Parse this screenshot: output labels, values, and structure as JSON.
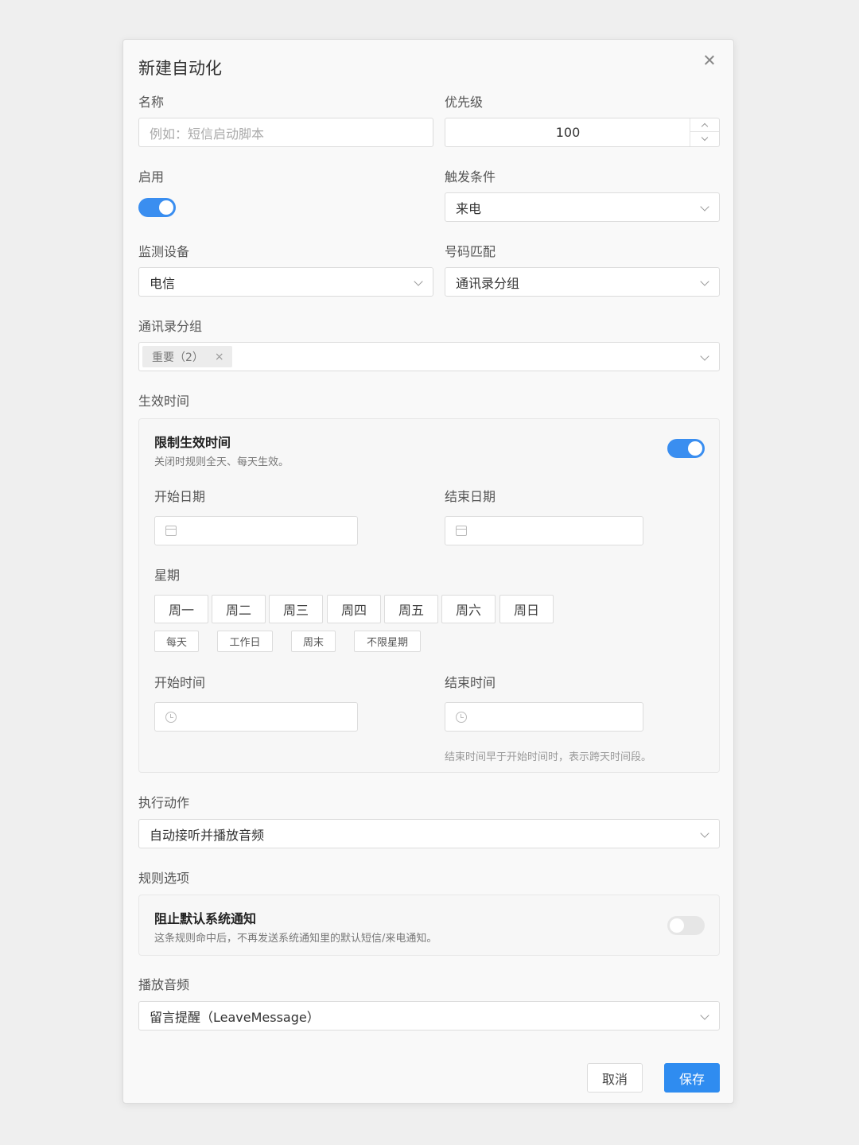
{
  "dialog": {
    "title": "新建自动化"
  },
  "name_field": {
    "label": "名称",
    "placeholder": "例如：短信启动脚本",
    "value": ""
  },
  "priority_field": {
    "label": "优先级",
    "value": "100"
  },
  "enabled_field": {
    "label": "启用",
    "on": true
  },
  "trigger_field": {
    "label": "触发条件",
    "value": "来电"
  },
  "device_field": {
    "label": "监测设备",
    "value": "电信"
  },
  "number_match_field": {
    "label": "号码匹配",
    "value": "通讯录分组"
  },
  "contact_group_field": {
    "label": "通讯录分组",
    "tags": [
      {
        "label": "重要（2）",
        "remove_symbol": "×"
      }
    ]
  },
  "effective_time": {
    "section_label": "生效时间",
    "limit_title": "限制生效时间",
    "limit_desc": "关闭时规则全天、每天生效。",
    "limit_on": true,
    "start_date_label": "开始日期",
    "end_date_label": "结束日期",
    "start_date_value": "",
    "end_date_value": "",
    "weekday_label": "星期",
    "weekdays": [
      "周一",
      "周二",
      "周三",
      "周四",
      "周五",
      "周六",
      "周日"
    ],
    "quick_options": [
      "每天",
      "工作日",
      "周末",
      "不限星期"
    ],
    "start_time_label": "开始时间",
    "end_time_label": "结束时间",
    "start_time_value": "",
    "end_time_value": "",
    "time_hint": "结束时间早于开始时间时，表示跨天时间段。"
  },
  "action_field": {
    "label": "执行动作",
    "value": "自动接听并播放音频"
  },
  "rule_options": {
    "section_label": "规则选项",
    "block_title": "阻止默认系统通知",
    "block_desc": "这条规则命中后，不再发送系统通知里的默认短信/来电通知。",
    "block_on": false
  },
  "audio_field": {
    "label": "播放音频",
    "value": "留言提醒（LeaveMessage）"
  },
  "footer": {
    "cancel_label": "取消",
    "save_label": "保存"
  },
  "colors": {
    "accent": "#2f8cf0",
    "toggle_on": "#3a8ef0",
    "toggle_off": "#e6e6e6"
  }
}
